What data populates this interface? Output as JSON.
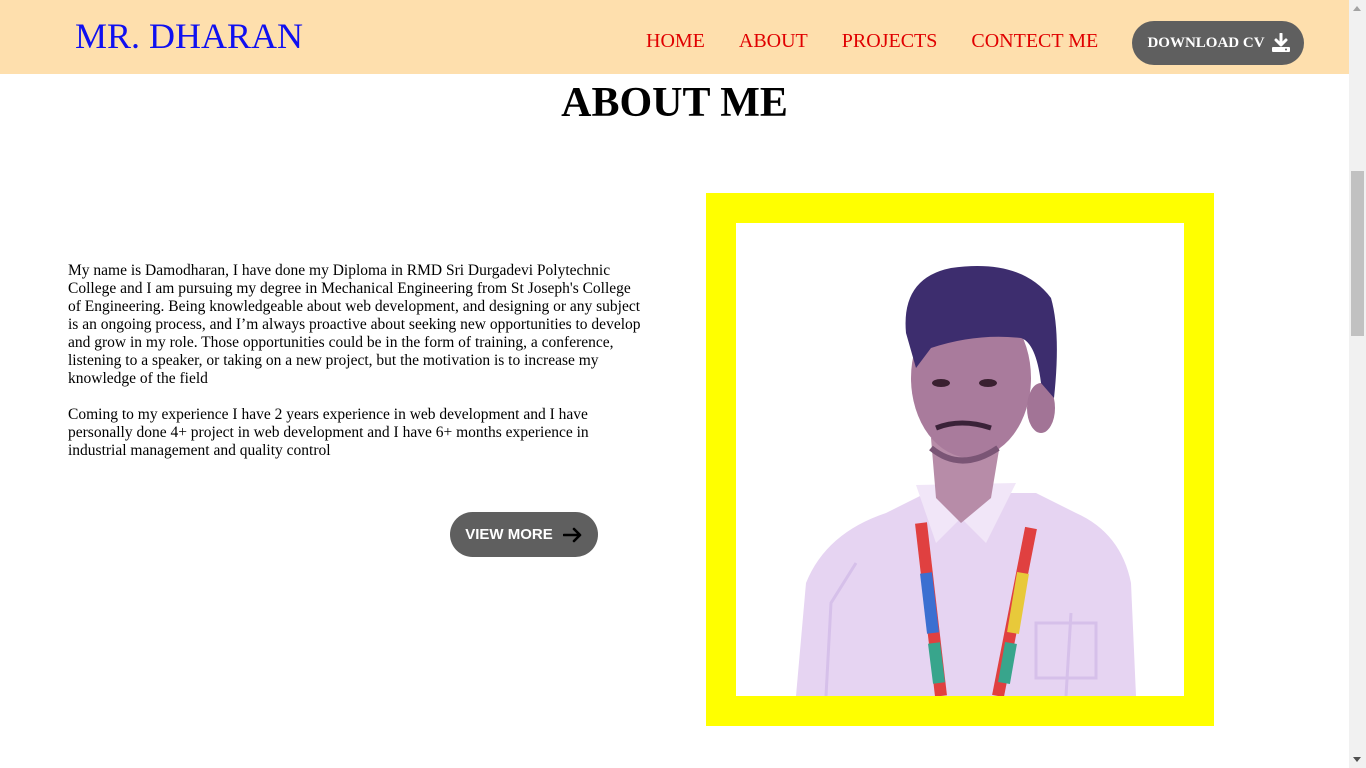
{
  "header": {
    "brand": "MR. DHARAN",
    "nav": [
      {
        "label": "HOME"
      },
      {
        "label": "ABOUT"
      },
      {
        "label": "PROJECTS"
      },
      {
        "label": "CONTECT ME"
      }
    ],
    "download_cv": {
      "label": "DOWNLOAD CV",
      "icon": "download-icon"
    }
  },
  "about": {
    "title": "ABOUT ME",
    "paragraphs": [
      "My name is Damodharan, I have done my Diploma in RMD Sri Durgadevi Polytechnic College and I am pursuing my degree in Mechanical Engineering from St Joseph's College of Engineering. Being knowledgeable about web development, and designing or any subject is an ongoing process, and I’m always proactive about seeking new opportunities to develop and grow in my role. Those opportunities could be in the form of training, a conference, listening to a speaker, or taking on a new project, but the motivation is to increase my knowledge of the field",
      "Coming to my experience I have 2 years experience in web development and I have personally done 4+ project in web development and I have 6+ months experience in industrial management and quality control"
    ],
    "view_more": {
      "label": "VIEW MORE",
      "icon": "arrow-right-icon"
    },
    "photo": {
      "frame_color": "#ffff00",
      "description_icon": "profile-photo"
    }
  },
  "colors": {
    "header_bg": "#fedfad",
    "brand": "#1010f0",
    "nav_link": "#e00000",
    "button_bg": "#5f5f5f"
  }
}
